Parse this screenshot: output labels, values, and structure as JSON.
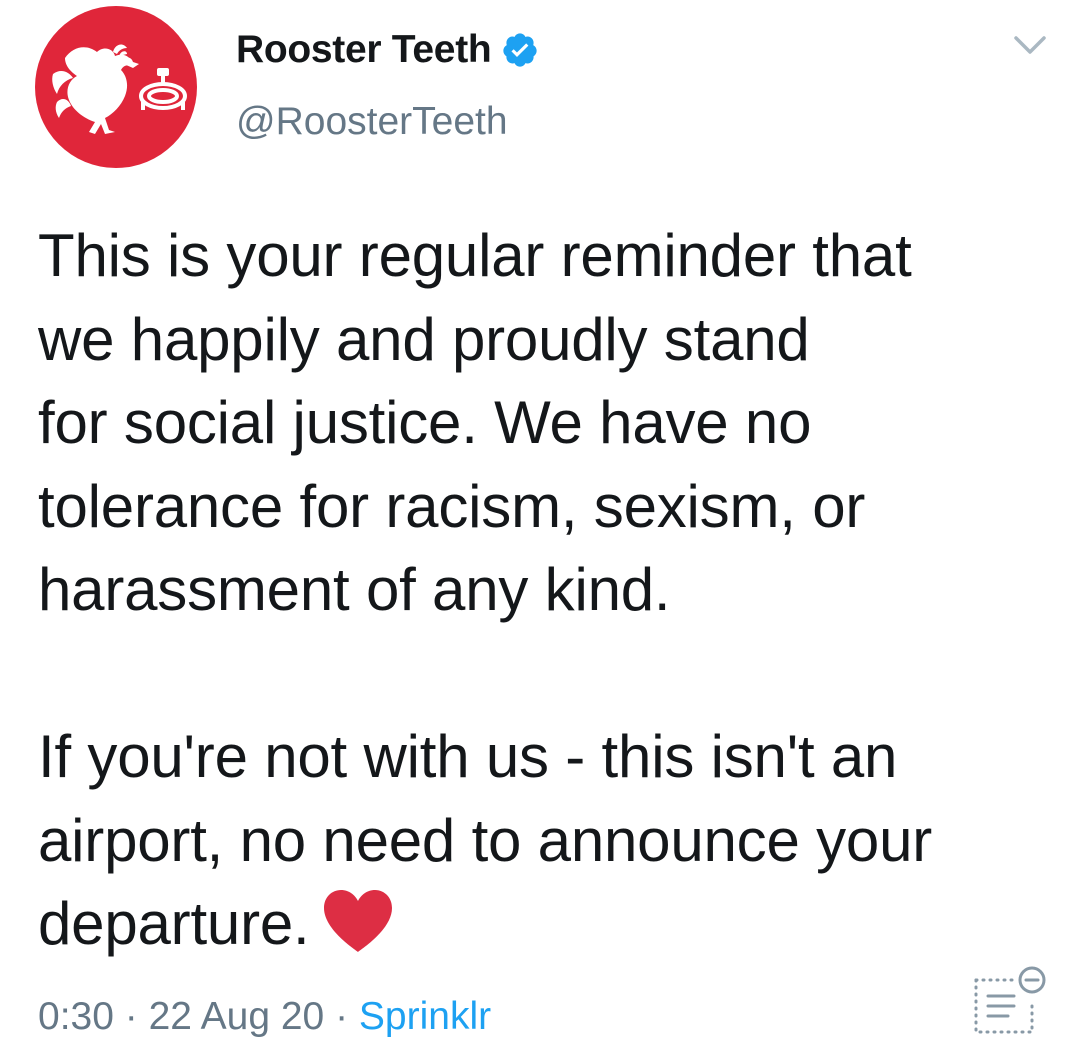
{
  "author": {
    "display_name": "Rooster Teeth",
    "handle": "@RoosterTeeth",
    "avatar_icon": "rooster-logo-icon",
    "verified_icon": "verified-badge-icon",
    "verified_color": "#1da1f2"
  },
  "tweet": {
    "paragraph_1": "This is your regular reminder that\nwe happily and proudly stand\nfor social justice. We have no\ntolerance for racism, sexism, or\nharassment of any kind.",
    "paragraph_2": "If you're not with us - this isn't an\nairport, no need to announce your\ndeparture.",
    "emoji": "red-heart-icon"
  },
  "meta": {
    "time": "0:30",
    "separator": " · ",
    "date": "22 Aug 20",
    "source": "Sprinklr"
  },
  "colors": {
    "brand_red": "#e0263a",
    "link_blue": "#1da1f2",
    "secondary_text": "#657786",
    "heart_red": "#dd2e44"
  },
  "icons": {
    "menu": "chevron-down-icon",
    "analytics": "tweet-analytics-icon"
  }
}
